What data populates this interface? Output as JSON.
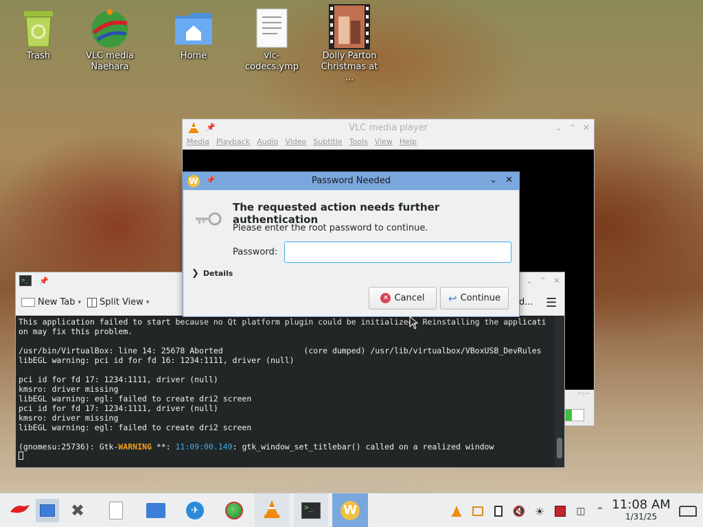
{
  "desktop": {
    "icons": [
      {
        "label": "Trash",
        "icon": "trash-icon"
      },
      {
        "label": "VLC media",
        "label2": "Naehara",
        "icon": "globe-icon"
      },
      {
        "label": "Home",
        "icon": "home-folder-icon"
      },
      {
        "label": "vlc-codecs.ymp",
        "icon": "document-icon"
      },
      {
        "label": "Dolly Parton",
        "label2": "Christmas at ...",
        "icon": "video-file-icon"
      }
    ]
  },
  "vlc": {
    "title": "VLC media player",
    "menu": [
      "Media",
      "Playback",
      "Audio",
      "Video",
      "Subtitle",
      "Tools",
      "View",
      "Help"
    ],
    "time": "--:--"
  },
  "terminal": {
    "toolbar": {
      "new_tab": "New Tab",
      "split_view": "Split View",
      "partial": "d..."
    },
    "lines": [
      "This application failed to start because no Qt platform plugin could be initialized. Reinstalling the applicati",
      "on may fix this problem.",
      "",
      "/usr/bin/VirtualBox: line 14: 25678 Aborted                 (core dumped) /usr/lib/virtualbox/VBoxUSB_DevRules",
      "libEGL warning: pci id for fd 16: 1234:1111, driver (null)",
      "",
      "pci id for fd 17: 1234:1111, driver (null)",
      "kmsro: driver missing",
      "libEGL warning: egl: failed to create dri2 screen",
      "pci id for fd 17: 1234:1111, driver (null)",
      "kmsro: driver missing",
      "libEGL warning: egl: failed to create dri2 screen",
      ""
    ],
    "gtk_line": {
      "prefix": "(gnomesu:25736): Gtk-",
      "level": "WARNING",
      "mid": " **: ",
      "timestamp": "11:09:00.149",
      "suffix": ": gtk_window_set_titlebar() called on a realized window"
    }
  },
  "dialog": {
    "title": "Password Needed",
    "heading": "The requested action needs further authentication",
    "subtext": "Please enter the root password to continue.",
    "password_label": "Password:",
    "password_value": "",
    "details_label": "Details",
    "cancel_label": "Cancel",
    "continue_label": "Continue",
    "accent": "#7ba7df"
  },
  "taskbar": {
    "time": "11:08 AM",
    "date": "1/31/25"
  }
}
